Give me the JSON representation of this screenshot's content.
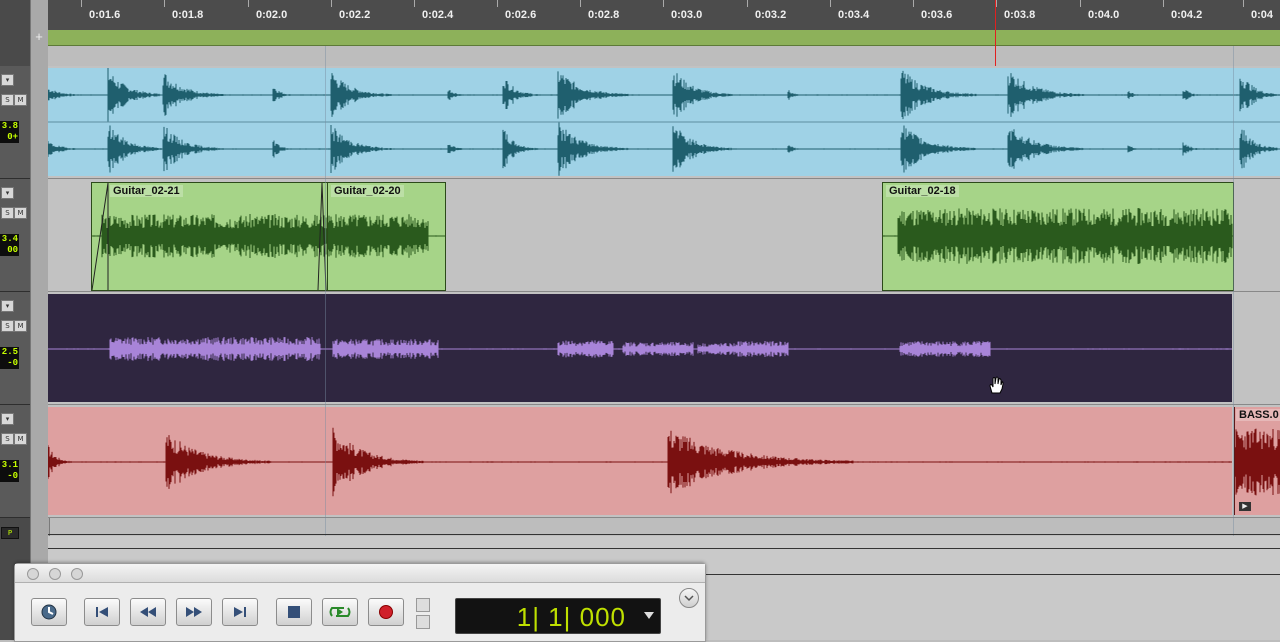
{
  "ruler": {
    "labels": [
      "0:01.6",
      "0:01.8",
      "0:02.0",
      "0:02.2",
      "0:02.4",
      "0:02.6",
      "0:02.8",
      "0:03.0",
      "0:03.2",
      "0:03.4",
      "0:03.6",
      "0:03.8",
      "0:04.0",
      "0:04.2",
      "0:04"
    ]
  },
  "track_readouts": [
    "3.8",
    "0+",
    "3.4",
    "00",
    "2.5",
    "-0",
    "3.1",
    "-0"
  ],
  "track_buttons": [
    "P"
  ],
  "tracks": {
    "drums": {
      "color": "#9fd2e6",
      "wave": "#1f5f6e"
    },
    "guitar": {
      "clips": [
        {
          "name": "Guitar_02-21"
        },
        {
          "name": "Guitar_02-20"
        },
        {
          "name": "Guitar_02-18"
        }
      ],
      "color": "#a6d488",
      "wave": "#2a5a1d"
    },
    "synth": {
      "color": "#2f2640",
      "wave": "#a884d8"
    },
    "bass": {
      "color": "#dea0a0",
      "wave": "#7a1010",
      "clip_name": "BASS.0"
    }
  },
  "transport": {
    "counter": "1| 1| 000",
    "buttons": [
      "online",
      "return-to-zero",
      "rewind",
      "fast-forward",
      "go-to-end",
      "stop",
      "play",
      "record"
    ]
  }
}
